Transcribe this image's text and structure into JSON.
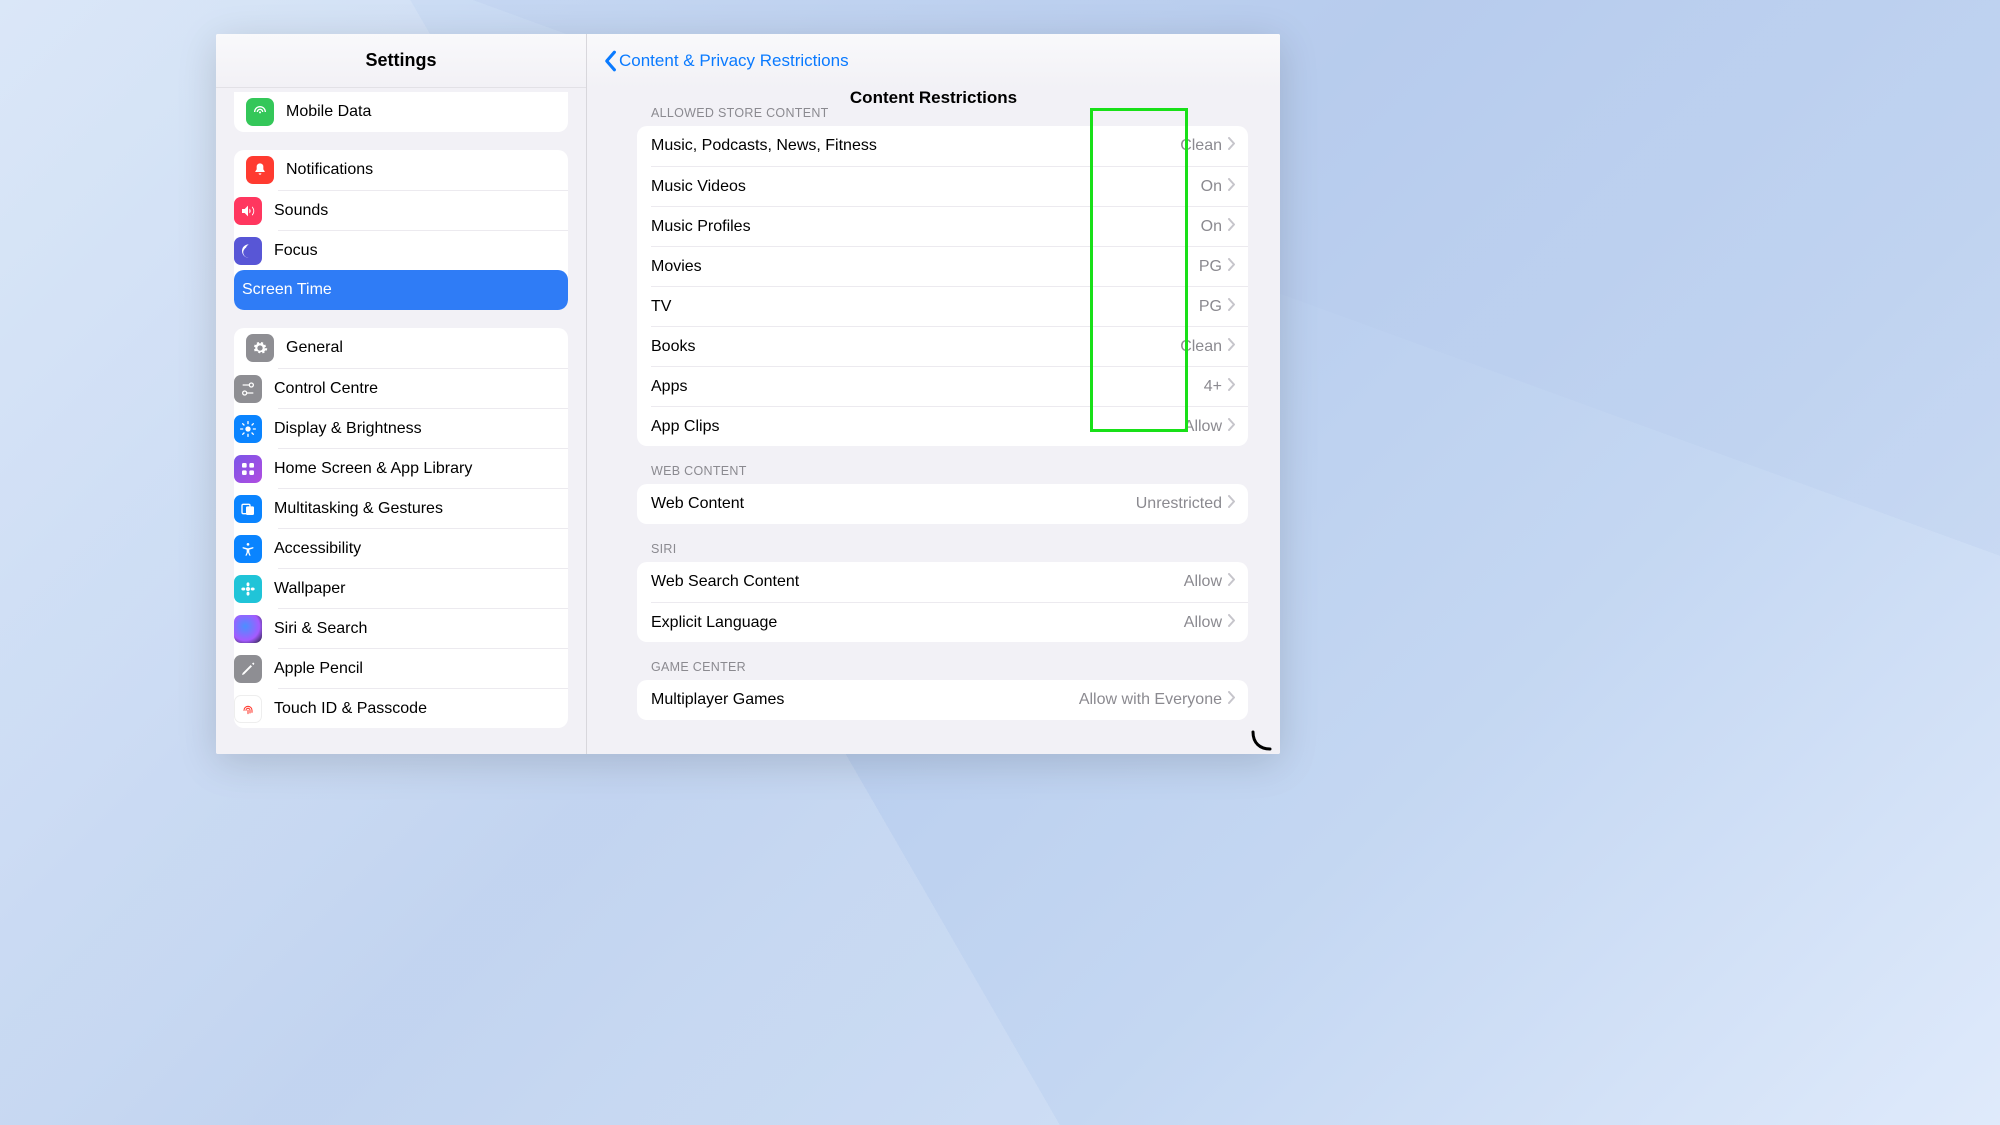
{
  "sidebar": {
    "title": "Settings",
    "group1": [
      {
        "label": "Mobile Data",
        "icon_name": "antenna-icon",
        "icon_bg": "#34c759"
      }
    ],
    "group2": [
      {
        "label": "Notifications",
        "icon_name": "bell-icon",
        "icon_bg": "#ff3b30"
      },
      {
        "label": "Sounds",
        "icon_name": "speaker-icon",
        "icon_bg": "#ff375f"
      },
      {
        "label": "Focus",
        "icon_name": "moon-icon",
        "icon_bg": "#5856d6"
      },
      {
        "label": "Screen Time",
        "icon_name": "hourglass-icon",
        "icon_bg": "#5856d6",
        "selected": true
      }
    ],
    "group3": [
      {
        "label": "General",
        "icon_name": "gear-icon",
        "icon_bg": "#8e8e93"
      },
      {
        "label": "Control Centre",
        "icon_name": "switches-icon",
        "icon_bg": "#8e8e93"
      },
      {
        "label": "Display & Brightness",
        "icon_name": "sun-icon",
        "icon_bg": "#0a84ff"
      },
      {
        "label": "Home Screen & App Library",
        "icon_name": "grid-icon",
        "icon_bg": "#5452d4"
      },
      {
        "label": "Multitasking & Gestures",
        "icon_name": "rectangles-icon",
        "icon_bg": "#0a84ff"
      },
      {
        "label": "Accessibility",
        "icon_name": "person-icon",
        "icon_bg": "#0a84ff"
      },
      {
        "label": "Wallpaper",
        "icon_name": "flower-icon",
        "icon_bg": "#20c4d8"
      },
      {
        "label": "Siri & Search",
        "icon_name": "siri-icon",
        "icon_bg": "#1b1b2e"
      },
      {
        "label": "Apple Pencil",
        "icon_name": "pencil-icon",
        "icon_bg": "#8e8e93"
      },
      {
        "label": "Touch ID & Passcode",
        "icon_name": "fingerprint-icon",
        "icon_bg": "#ffffff"
      }
    ]
  },
  "main": {
    "back_label": "Content & Privacy Restrictions",
    "title": "Content Restrictions",
    "sections": {
      "store": {
        "header": "Allowed Store Content",
        "rows": [
          {
            "label": "Music, Podcasts, News, Fitness",
            "value": "Clean"
          },
          {
            "label": "Music Videos",
            "value": "On"
          },
          {
            "label": "Music Profiles",
            "value": "On"
          },
          {
            "label": "Movies",
            "value": "PG"
          },
          {
            "label": "TV",
            "value": "PG"
          },
          {
            "label": "Books",
            "value": "Clean"
          },
          {
            "label": "Apps",
            "value": "4+"
          },
          {
            "label": "App Clips",
            "value": "Allow"
          }
        ]
      },
      "web": {
        "header": "Web Content",
        "rows": [
          {
            "label": "Web Content",
            "value": "Unrestricted"
          }
        ]
      },
      "siri": {
        "header": "Siri",
        "rows": [
          {
            "label": "Web Search Content",
            "value": "Allow"
          },
          {
            "label": "Explicit Language",
            "value": "Allow"
          }
        ]
      },
      "gamecenter": {
        "header": "Game Center",
        "rows": [
          {
            "label": "Multiplayer Games",
            "value": "Allow with Everyone"
          }
        ]
      }
    }
  }
}
